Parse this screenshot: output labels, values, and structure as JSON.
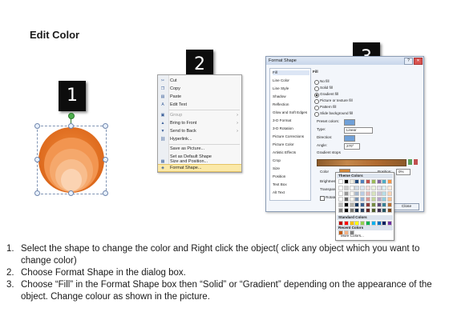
{
  "title": "Edit Color",
  "badges": [
    "1",
    "2",
    "3"
  ],
  "context_menu": {
    "items": [
      {
        "label": "Cut",
        "icon": "cut-icon",
        "glyph": "✂",
        "disabled": false,
        "arrow": false
      },
      {
        "label": "Copy",
        "icon": "copy-icon",
        "glyph": "❐",
        "disabled": false,
        "arrow": false
      },
      {
        "label": "Paste",
        "icon": "paste-icon",
        "glyph": "▤",
        "disabled": false,
        "arrow": false
      },
      {
        "label": "Edit Text",
        "icon": "edit-text-icon",
        "glyph": "A",
        "disabled": false,
        "arrow": false
      },
      {
        "label": "Group",
        "icon": "group-icon",
        "glyph": "▣",
        "disabled": true,
        "arrow": true
      },
      {
        "label": "Bring to Front",
        "icon": "bring-front-icon",
        "glyph": "▲",
        "disabled": false,
        "arrow": true
      },
      {
        "label": "Send to Back",
        "icon": "send-back-icon",
        "glyph": "▼",
        "disabled": false,
        "arrow": true
      },
      {
        "label": "Hyperlink...",
        "icon": "hyperlink-icon",
        "glyph": "⛓",
        "disabled": false,
        "arrow": false
      },
      {
        "label": "Save as Picture...",
        "icon": "",
        "glyph": "",
        "disabled": false,
        "arrow": false
      },
      {
        "label": "Set as Default Shape",
        "icon": "",
        "glyph": "",
        "disabled": false,
        "arrow": false
      },
      {
        "label": "Size and Position...",
        "icon": "size-icon",
        "glyph": "▦",
        "disabled": false,
        "arrow": false
      },
      {
        "label": "Format Shape...",
        "icon": "format-shape-icon",
        "glyph": "◈",
        "disabled": false,
        "arrow": false,
        "highlighted": true
      }
    ]
  },
  "dialog": {
    "title": "Format Shape",
    "categories": [
      "Fill",
      "Line Color",
      "Line Style",
      "Shadow",
      "Reflection",
      "Glow and Soft Edges",
      "3-D Format",
      "3-D Rotation",
      "Picture Corrections",
      "Picture Color",
      "Artistic Effects",
      "Crop",
      "Size",
      "Position",
      "Text Box",
      "Alt Text"
    ],
    "selected_category": "Fill",
    "fill_heading": "Fill",
    "fill_options": [
      "No fill",
      "Solid fill",
      "Gradient fill",
      "Picture or texture fill",
      "Pattern fill",
      "Slide background fill"
    ],
    "selected_fill": "Gradient fill",
    "preset_label": "Preset colors:",
    "type_label": "Type:",
    "type_value": "Linear",
    "direction_label": "Direction:",
    "angle_label": "Angle:",
    "angle_value": "270°",
    "stops_label": "Gradient stops",
    "color_label": "Color",
    "position_label": "Position:",
    "position_value": "0%",
    "brightness_label": "Brightness:",
    "transparency_label": "Transparen",
    "rotate_label": "Rotate w",
    "close_label": "Close"
  },
  "palette": {
    "theme_label": "Theme Colors",
    "standard_label": "Standard Colors",
    "recent_label": "Recent Colors",
    "more_label": "More Colors...",
    "theme_top": [
      "#ffffff",
      "#000000",
      "#eeece1",
      "#1f497d",
      "#4f81bd",
      "#c0504d",
      "#9bbb59",
      "#8064a2",
      "#4bacc6",
      "#f79646"
    ],
    "standard": [
      "#c00000",
      "#ff0000",
      "#ffc000",
      "#ffff00",
      "#92d050",
      "#00b050",
      "#00b0f0",
      "#0070c0",
      "#002060",
      "#7030a0"
    ],
    "recent": [
      "#c55a11",
      "#f4b183",
      "#7f7f7f"
    ]
  },
  "instructions": [
    {
      "num": "1.",
      "text": "Select the shape to change the color and Right click the object( click any object which you want to change color)"
    },
    {
      "num": "2.",
      "text": "Choose Format Shape in the dialog box."
    },
    {
      "num": "3.",
      "text": "Choose “Fill” in the Format Shape box then “Solid” or “Gradient” depending on the appearance of the object. Change colour as shown in the picture."
    }
  ]
}
